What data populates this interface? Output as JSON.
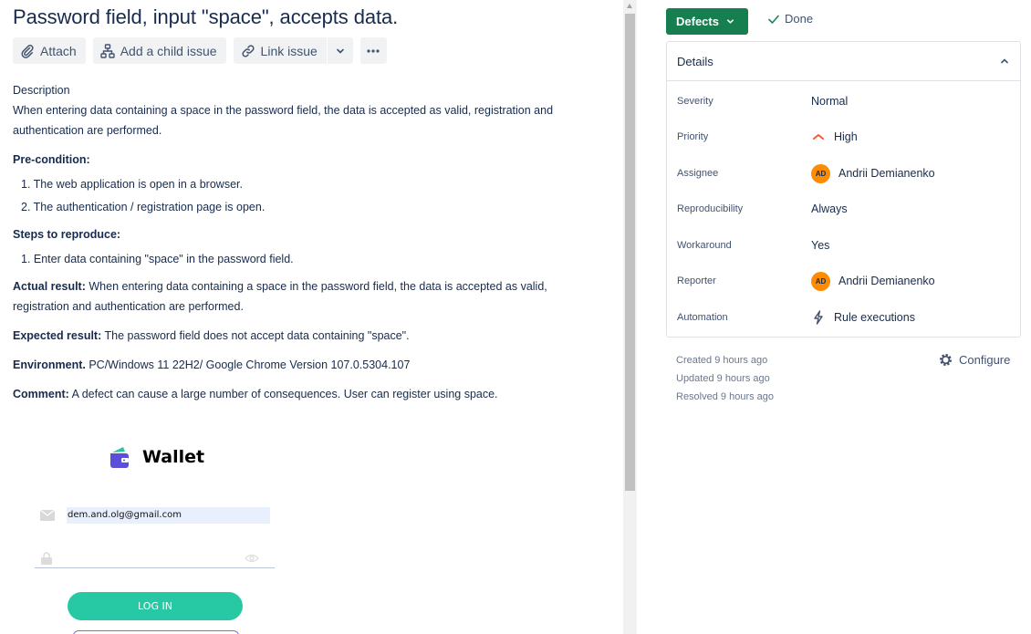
{
  "issue": {
    "title": "Password field, input \"space\", accepts data."
  },
  "toolbar": {
    "attach": "Attach",
    "add_child": "Add a child issue",
    "link_issue": "Link issue"
  },
  "description": {
    "heading": "Description",
    "text": "When entering data containing a space in the password field, the data is accepted as valid, registration and authentication are performed.",
    "precondition_heading": "Pre-condition:",
    "preconditions": [
      "1. The web application is open in a browser.",
      "2. The authentication / registration page is open."
    ],
    "steps_heading": "Steps to reproduce:",
    "steps": [
      "1. Enter data containing \"space\" in the password field."
    ],
    "actual_label": "Actual result:",
    "actual_text": " When entering data containing a space in the password field, the data is accepted as valid, registration and authentication are performed.",
    "expected_label": "Expected result:",
    "expected_text": " The password field does not accept data containing \"space\".",
    "environment_label": "Environment.",
    "environment_text": " PC/Windows 11 22H2/ Google Chrome Version 107.0.5304.107",
    "comment_label": "Comment:",
    "comment_text": " A defect can cause a large number of consequences. User can register using space."
  },
  "attachment": {
    "app_name": "Wallet",
    "email_value": "dem.and.olg@gmail.com",
    "login_label": "LOG IN"
  },
  "sidebar": {
    "status_label": "Defects",
    "resolution_label": "Done",
    "details_label": "Details",
    "fields": [
      {
        "key": "Severity",
        "value": "Normal"
      },
      {
        "key": "Priority",
        "value": "High"
      },
      {
        "key": "Assignee",
        "value": "Andrii Demianenko",
        "initials": "AD"
      },
      {
        "key": "Reproducibility",
        "value": "Always"
      },
      {
        "key": "Workaround",
        "value": "Yes"
      },
      {
        "key": "Reporter",
        "value": "Andrii Demianenko",
        "initials": "AD"
      },
      {
        "key": "Automation",
        "value": "Rule executions"
      }
    ],
    "created": "Created 9 hours ago",
    "updated": "Updated 9 hours ago",
    "resolved": "Resolved 9 hours ago",
    "configure_label": "Configure"
  },
  "colors": {
    "status_button": "#167f50",
    "priority_high": "#ff5630",
    "avatar": "#ff8b00",
    "login_button": "#26c9a4"
  }
}
